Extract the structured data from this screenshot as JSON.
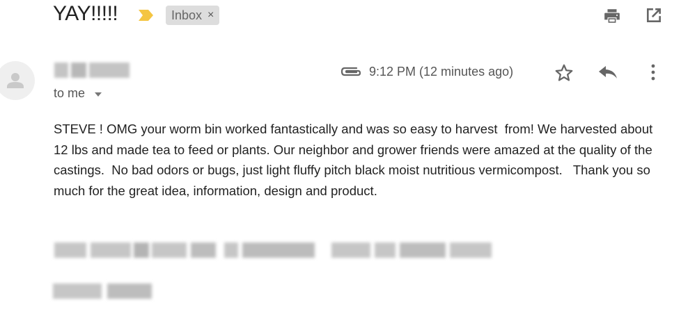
{
  "subject": {
    "title": "YAY!!!!!",
    "label": "Inbox",
    "label_remove": "×"
  },
  "icons": {
    "importance": "importance-marker-icon",
    "print": "printer-icon",
    "popout": "open-in-new-window-icon",
    "attachment": "paperclip-icon",
    "star": "star-icon",
    "reply": "reply-icon",
    "more": "more-vertical-icon",
    "avatar": "person-icon"
  },
  "colors": {
    "importance_marker": "#f4c542",
    "chip_bg": "#dddddd",
    "icon_gray": "#666666",
    "text": "#222222"
  },
  "header": {
    "recipient": "to me",
    "timestamp": "9:12 PM (12 minutes ago)"
  },
  "message": {
    "body": "STEVE ! OMG your worm bin worked fantastically and was so easy to harvest  from! We harvested about 12 lbs and made tea to feed or plants. Our neighbor and grower friends were amazed at the quality of the castings.  No bad odors or bugs, just light fluffy pitch black moist nutritious vermicompost.   Thank you so much for the great idea, information, design and product."
  }
}
